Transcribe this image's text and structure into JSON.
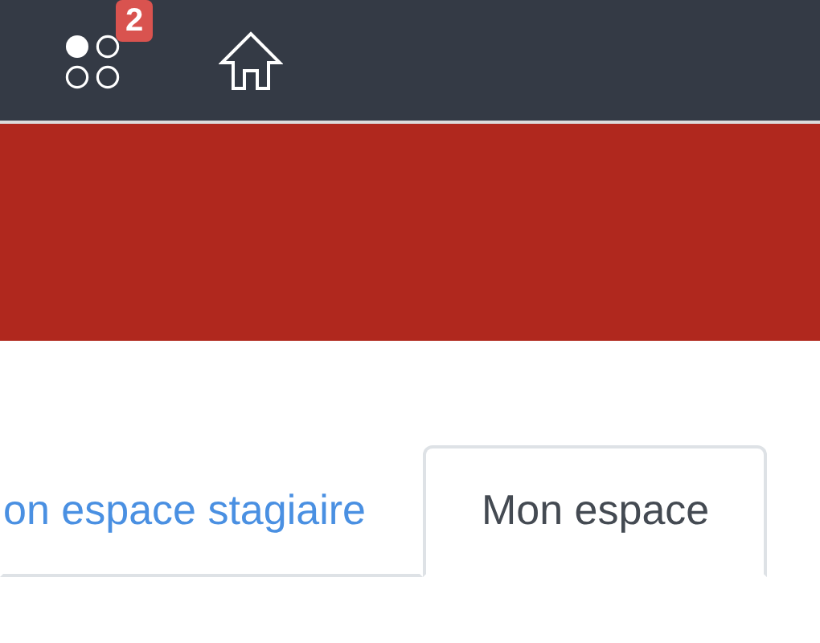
{
  "top_bar": {
    "apps_badge": "2"
  },
  "tabs": [
    {
      "label": "on espace stagiaire",
      "selected": false
    },
    {
      "label": "Mon espace",
      "selected": true
    }
  ]
}
